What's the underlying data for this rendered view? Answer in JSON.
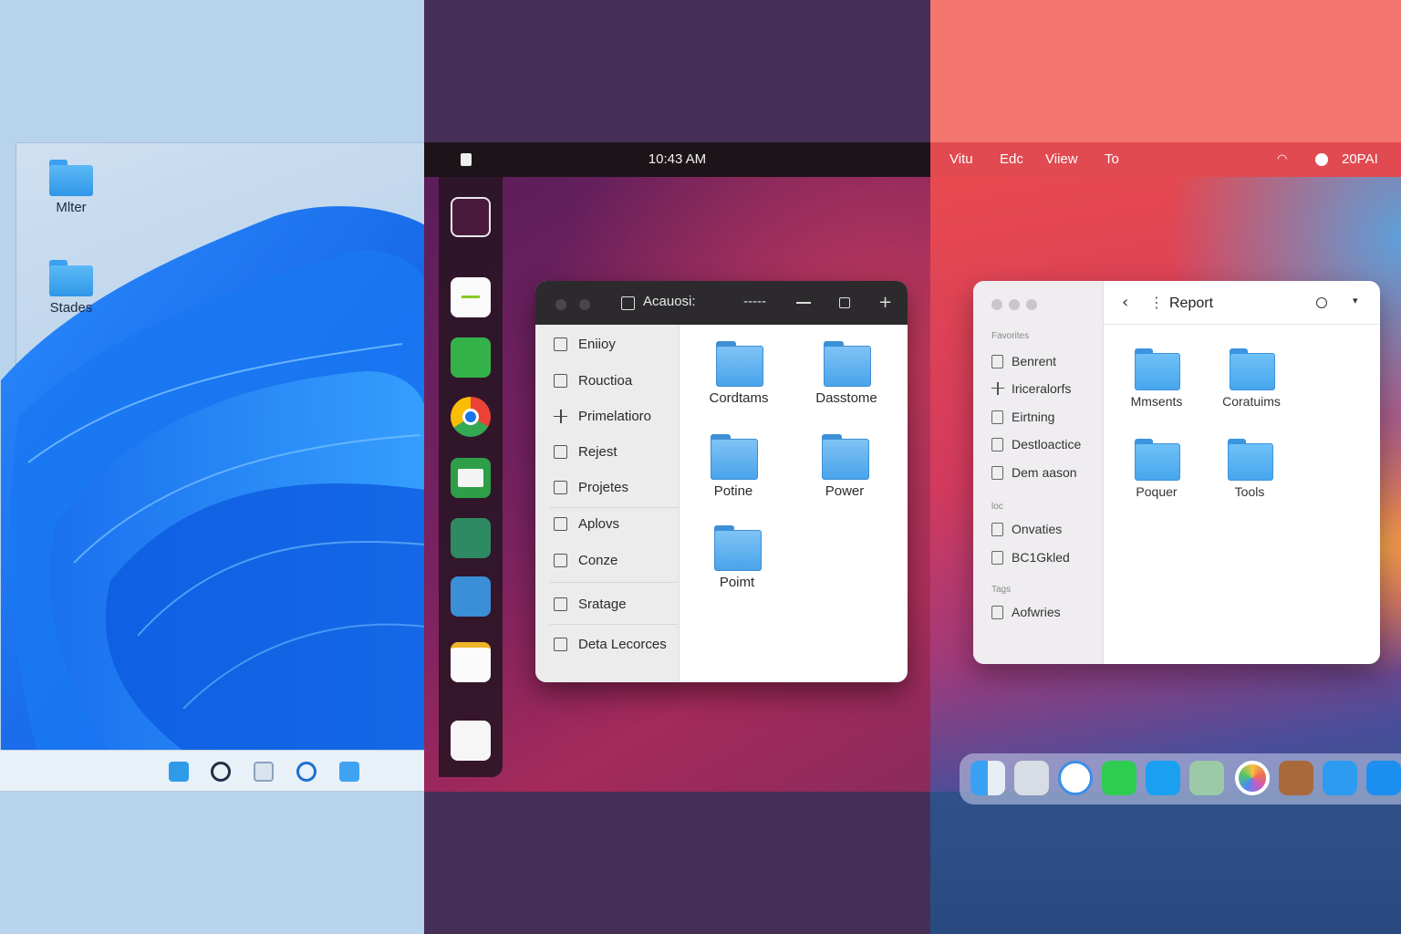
{
  "windows": {
    "desktop_icons": [
      {
        "label": "Mlter",
        "icon": "store-folder-icon"
      },
      {
        "label": "Stades",
        "icon": "folder-icon"
      }
    ],
    "taskbar_icons": [
      "explorer-icon",
      "search-icon",
      "taskview-icon",
      "edge-icon",
      "store-icon"
    ]
  },
  "ubuntu": {
    "clock": "10:43 AM",
    "dock_apps": [
      "camera-icon",
      "text-editor-icon",
      "store-icon",
      "chrome-icon",
      "mail-icon",
      "spreadsheet-icon",
      "files-icon",
      "notes-icon",
      "document-icon"
    ],
    "window": {
      "title": "Acauosi:",
      "menu_dashes": "-----",
      "sidebar": [
        {
          "label": "Eniioy",
          "icon": "table"
        },
        {
          "label": "Rouctioa",
          "icon": "box"
        },
        {
          "label": "Primelatioro",
          "icon": "plus"
        },
        {
          "label": "Rejest",
          "icon": "box"
        },
        {
          "label": "Projetes",
          "icon": "box"
        },
        {
          "label": "Aplovs",
          "icon": "box"
        },
        {
          "label": "Conze",
          "icon": "box"
        },
        {
          "label": "Sratage",
          "icon": "box"
        },
        {
          "label": "Deta Lecorces",
          "icon": "box"
        }
      ],
      "folders": [
        "Cordtams",
        "Dasstome",
        "Potine",
        "Power",
        "Poimt"
      ]
    }
  },
  "mac": {
    "menubar": [
      "Vitu",
      "Edc",
      "Viiew",
      "To"
    ],
    "status_time": "20PAI",
    "window": {
      "title": "Report",
      "sections": [
        "Favorites",
        "loc",
        "Tags"
      ],
      "sidebar": [
        {
          "label": "Benrent",
          "icon": "box"
        },
        {
          "label": "Iriceralorfs",
          "icon": "plus"
        },
        {
          "label": "Eirtning",
          "icon": "box"
        },
        {
          "label": "Destloactice",
          "icon": "box"
        },
        {
          "label": "Dem aason",
          "icon": "box"
        },
        {
          "label": "Onvaties",
          "icon": "box"
        },
        {
          "label": "BC1Gkled",
          "icon": "box"
        },
        {
          "label": "Aofwries",
          "icon": "box"
        }
      ],
      "folders": [
        "Mmsents",
        "Coratuims",
        "Poquer",
        "Tools"
      ]
    },
    "dock_apps": [
      "finder-icon",
      "preview-icon",
      "safari-icon",
      "messages-icon",
      "mail-icon",
      "maps-icon",
      "photos-icon",
      "contacts-icon",
      "mail-app-icon",
      "appstore-icon"
    ]
  },
  "colors": {
    "windows_accent": "#1a73e8",
    "ubuntu_accent": "#7a2261",
    "mac_accent": "#e04a50"
  }
}
